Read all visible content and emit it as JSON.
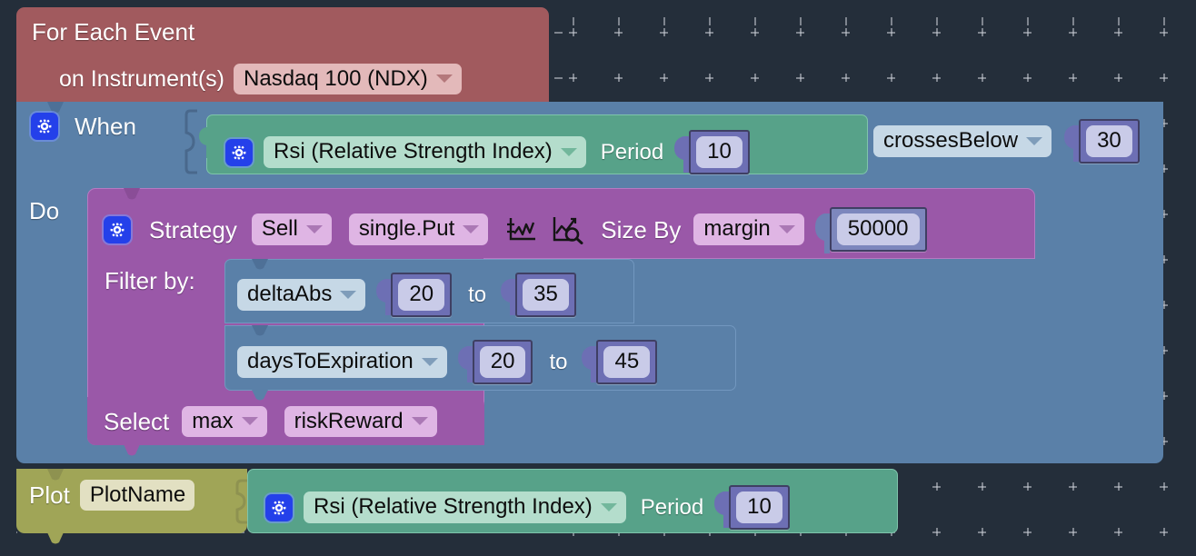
{
  "workspace": {
    "background_color": "#242e3a",
    "grid_mark": "plus-grid"
  },
  "blocks": {
    "for_each_event": {
      "color": "#a15a5e",
      "title": "For Each Event",
      "instrument_label": "on Instrument(s)",
      "instrument_value": "Nasdaq 100 (NDX)"
    },
    "when": {
      "color": "#5a80a8",
      "label": "When",
      "gear_icon": "gear-icon",
      "condition": {
        "color": "#57a289",
        "gear_icon": "gear-icon",
        "indicator": "Rsi (Relative Strength Index)",
        "period_label": "Period",
        "period_value": "10"
      },
      "comparator": "crossesBelow",
      "threshold_value": "30"
    },
    "do": {
      "label": "Do"
    },
    "strategy": {
      "color": "#9a58a8",
      "gear_icon": "gear-icon",
      "label": "Strategy",
      "side": "Sell",
      "leg": "single.Put",
      "chart_icon": "line-chart-icon",
      "analyze_icon": "chart-magnifier-icon",
      "size_by_label": "Size By",
      "size_by_value": "margin",
      "size_amount": "50000",
      "filter_label": "Filter by:",
      "filters": [
        {
          "field": "deltaAbs",
          "min": "20",
          "to_label": "to",
          "max": "35"
        },
        {
          "field": "daysToExpiration",
          "min": "20",
          "to_label": "to",
          "max": "45"
        }
      ],
      "select_label": "Select",
      "select_aggregate": "max",
      "select_metric": "riskReward"
    },
    "plot": {
      "color": "#a0a557",
      "label": "Plot",
      "name_value": "PlotName",
      "value": {
        "color": "#57a289",
        "gear_icon": "gear-icon",
        "indicator": "Rsi (Relative Strength Index)",
        "period_label": "Period",
        "period_value": "10"
      }
    }
  }
}
